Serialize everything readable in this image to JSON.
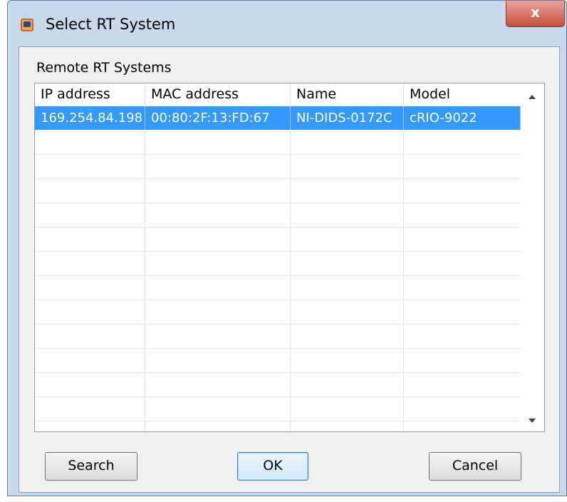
{
  "window": {
    "title": "Select RT System",
    "close_label": "x"
  },
  "group": {
    "label": "Remote RT Systems"
  },
  "table": {
    "columns": [
      "IP address",
      "MAC address",
      "Name",
      "Model"
    ],
    "rows": [
      [
        "169.254.84.198",
        "00:80:2F:13:FD:67",
        "NI-DIDS-0172C",
        "cRIO-9022"
      ]
    ],
    "selected_row": 0
  },
  "buttons": {
    "search": "Search",
    "ok": "OK",
    "cancel": "Cancel"
  },
  "colors": {
    "selection": "#3399ff",
    "close_button": "#c7503a",
    "frame": "#c7d9ec"
  },
  "icons": {
    "app": "labview-rt-icon",
    "scroll_up": "arrow-up-icon",
    "scroll_down": "arrow-down-icon"
  }
}
